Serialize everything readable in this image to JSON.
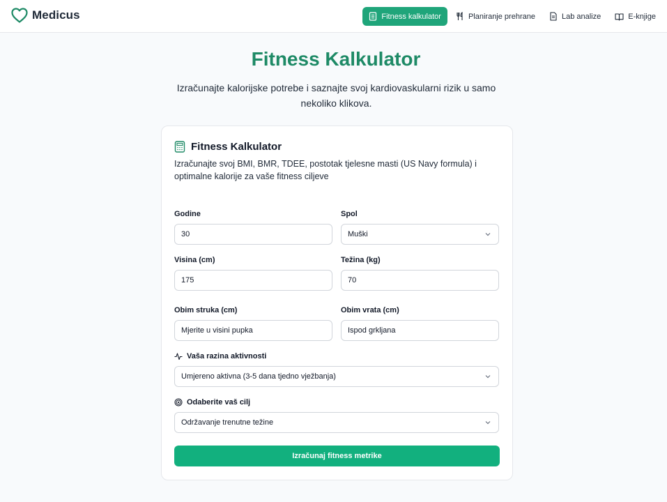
{
  "header": {
    "brand": "Medicus",
    "nav": [
      {
        "label": "Fitness kalkulator",
        "icon": "clipboard-icon",
        "active": true
      },
      {
        "label": "Planiranje prehrane",
        "icon": "utensils-icon",
        "active": false
      },
      {
        "label": "Lab analize",
        "icon": "document-icon",
        "active": false
      },
      {
        "label": "E-knjige",
        "icon": "book-icon",
        "active": false
      }
    ]
  },
  "hero": {
    "title": "Fitness Kalkulator",
    "subtitle": "Izračunajte kalorijske potrebe i saznajte svoj kardiovaskularni rizik u samo nekoliko klikova."
  },
  "card": {
    "title": "Fitness Kalkulator",
    "description": "Izračunajte svoj BMI, BMR, TDEE, postotak tjelesne masti (US Navy formula) i optimalne kalorije za vaše fitness ciljeve",
    "fields": {
      "age": {
        "label": "Godine",
        "value": "30"
      },
      "sex": {
        "label": "Spol",
        "value": "Muški"
      },
      "height": {
        "label": "Visina (cm)",
        "value": "175"
      },
      "weight": {
        "label": "Težina (kg)",
        "value": "70"
      },
      "waist": {
        "label": "Obim struka (cm)",
        "placeholder": "Mjerite u visini pupka"
      },
      "neck": {
        "label": "Obim vrata (cm)",
        "placeholder": "Ispod grkljana"
      },
      "activity": {
        "label": "Vaša razina aktivnosti",
        "value": "Umjereno aktivna (3-5 dana tjedno vježbanja)"
      },
      "goal": {
        "label": "Odaberite vaš cilj",
        "value": "Održavanje trenutne težine"
      }
    },
    "submit_label": "Izračunaj fitness metrike"
  },
  "colors": {
    "brand_green": "#1e8a66",
    "button_green": "#12b07e",
    "active_nav": "#1fa57a"
  }
}
